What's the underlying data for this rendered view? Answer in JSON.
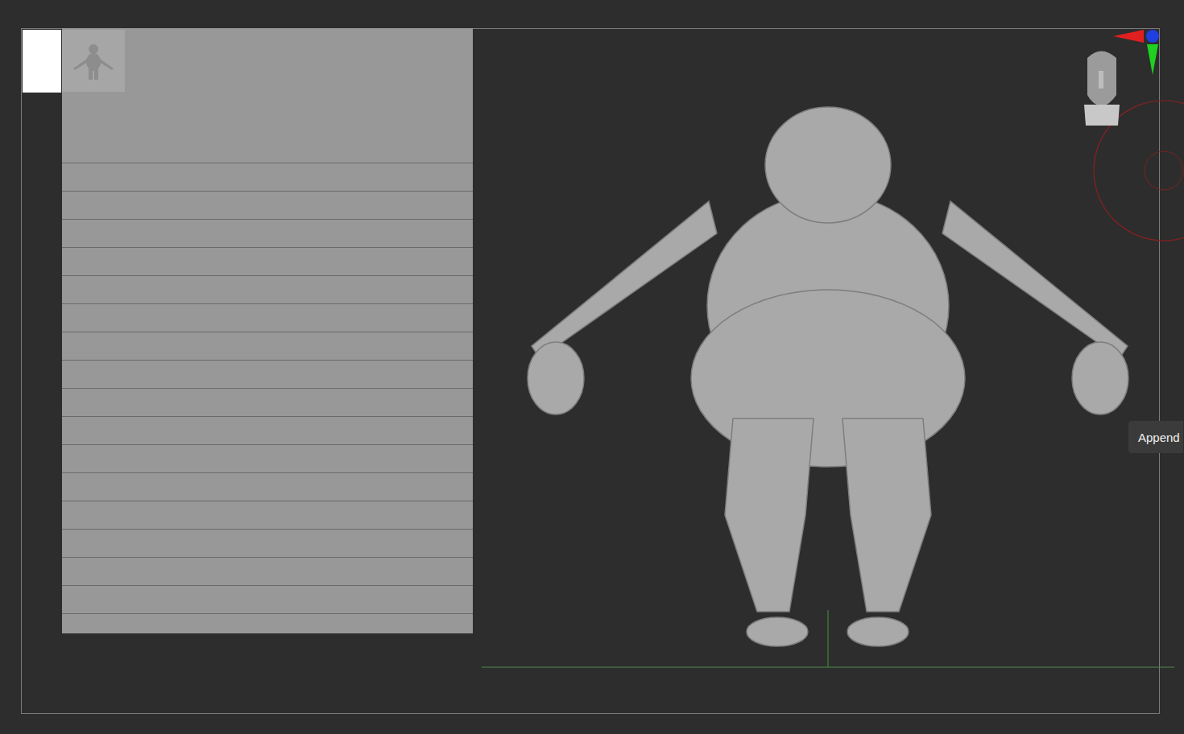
{
  "tooltip": {
    "label": "Append"
  }
}
